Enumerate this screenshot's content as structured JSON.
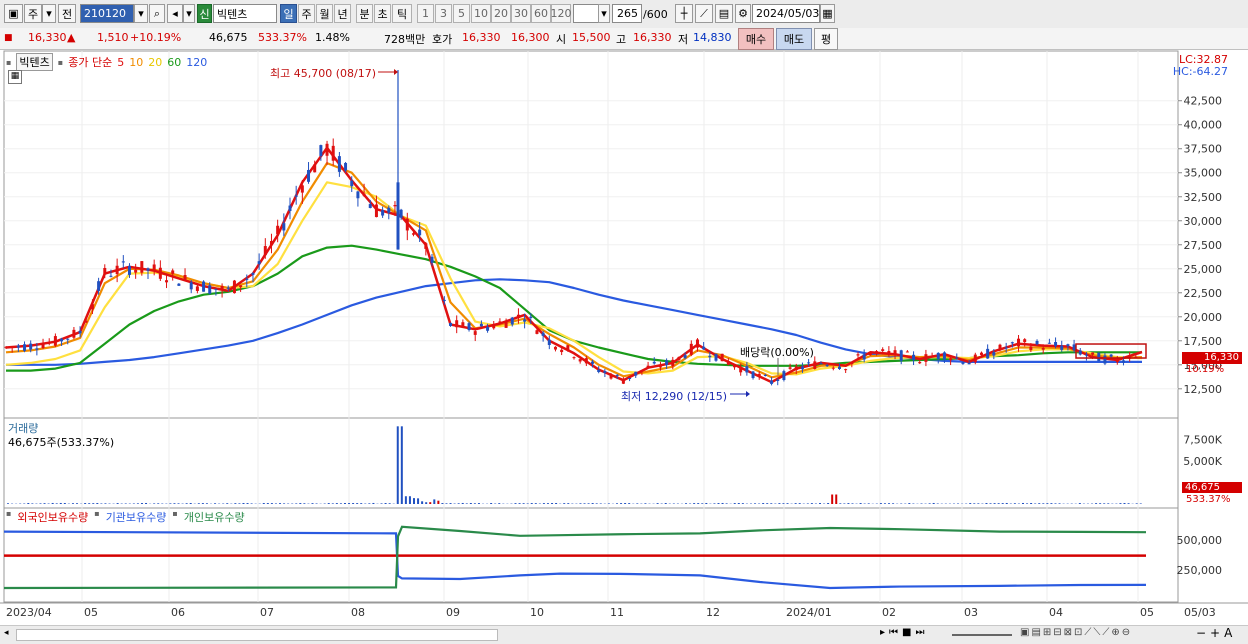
{
  "toolbar": {
    "mode_a": "주",
    "mode_b": "전",
    "code": "210120",
    "market_badge": "신",
    "stock_name": "빅텐츠",
    "periods": [
      "일",
      "주",
      "월",
      "년",
      "분",
      "초",
      "틱"
    ],
    "active_period": "일",
    "intervals": [
      "1",
      "3",
      "5",
      "10",
      "20",
      "30",
      "60",
      "120"
    ],
    "count": "265",
    "count_max": "/600",
    "date": "2024/05/03"
  },
  "quote": {
    "price": "16,330",
    "arrow": "▲",
    "change": "1,510",
    "change_pct": "+10.19%",
    "volume": "46,675",
    "volume_ratio": "533.37%",
    "turnover": "1.48%",
    "amount": "728백만",
    "bid_label": "호가",
    "bid1": "16,330",
    "bid2": "16,300",
    "open_label": "시",
    "open": "15,500",
    "high_label": "고",
    "high": "16,330",
    "low_label": "저",
    "low": "14,830",
    "buy_button": "매수",
    "sell_button": "매도",
    "avg_button": "평"
  },
  "price_panel": {
    "legend_name": "빅텐츠",
    "ma_label": "종가 단순",
    "ma_periods": [
      "5",
      "10",
      "20",
      "60",
      "120"
    ],
    "ma_colors": [
      "#e01010",
      "#f08c00",
      "#ffe040",
      "#1a9a1a",
      "#2a5ae0"
    ],
    "lc": "LC:32.87",
    "hc": "HC:-64.27",
    "annot_high": "최고 45,700 (08/17)",
    "annot_low": "최저 12,290 (12/15)",
    "annot_div": "배당락(0.00%)",
    "last_price_tag": "16,330",
    "last_pct_tag": "10.19%"
  },
  "volume_panel": {
    "title": "거래량",
    "subtitle": "46,675주(533.37%)",
    "last_tag": "46,675",
    "pct_tag": "533.37%"
  },
  "holding_panel": {
    "legend": [
      "외국인보유수량",
      "기관보유수량",
      "개인보유수량"
    ]
  },
  "chart_data": [
    {
      "type": "candlestick",
      "title": "빅텐츠",
      "yticks": [
        12500,
        15000,
        17500,
        20000,
        22500,
        25000,
        27500,
        30000,
        32500,
        35000,
        37500,
        40000,
        42500
      ],
      "ylim": [
        10500,
        45700
      ],
      "x": [
        "2023/04",
        "05",
        "06",
        "07",
        "08",
        "09",
        "10",
        "11",
        "12",
        "2024/01",
        "02",
        "03",
        "04",
        "05",
        "05/03"
      ],
      "ma5": [
        16800,
        17000,
        17400,
        18400,
        24500,
        25200,
        24800,
        24000,
        23200,
        22700,
        24500,
        28500,
        34000,
        37600,
        34200,
        31200,
        30500,
        27500,
        19200,
        18700,
        19300,
        20200,
        17500,
        16200,
        14500,
        13400,
        14700,
        15200,
        17100,
        15600,
        14400,
        13200,
        14600,
        15200,
        14900,
        16300,
        16100,
        15600,
        16100,
        15300,
        16400,
        17200,
        17000,
        16900,
        15800,
        15500,
        16330
      ],
      "ma10": [
        16300,
        16500,
        16900,
        17800,
        23500,
        25000,
        24900,
        24300,
        23500,
        23000,
        23700,
        27000,
        32000,
        36000,
        35000,
        32000,
        30500,
        29000,
        21500,
        18800,
        19200,
        19800,
        18200,
        16800,
        15000,
        13800,
        14300,
        14800,
        16500,
        16000,
        14900,
        13700,
        14200,
        14900,
        15000,
        15900,
        16000,
        15800,
        15900,
        15500,
        16100,
        16800,
        16800,
        16700,
        16000,
        15700,
        15800
      ],
      "ma20": [
        15000,
        15200,
        15600,
        16500,
        21000,
        24500,
        24600,
        24200,
        23500,
        23000,
        23200,
        25500,
        30000,
        34000,
        33500,
        32500,
        30500,
        29500,
        24000,
        19500,
        19000,
        19400,
        18800,
        17500,
        15800,
        14300,
        14100,
        14400,
        15800,
        15900,
        15200,
        14100,
        14000,
        14600,
        14900,
        15400,
        15700,
        15800,
        15800,
        15700,
        15900,
        16400,
        16600,
        16600,
        16200,
        15800,
        15700
      ],
      "ma60": [
        14400,
        14400,
        14600,
        15200,
        17200,
        19200,
        20600,
        21600,
        22300,
        22600,
        23200,
        24500,
        26300,
        27200,
        27400,
        27000,
        26500,
        26000,
        25200,
        24200,
        23000,
        20800,
        18600,
        17500,
        16800,
        16200,
        15600,
        15300,
        15100,
        15000,
        14900,
        14900,
        14900,
        15000,
        15200,
        15300,
        15400,
        15500,
        15600,
        15700,
        15900,
        16000,
        16200,
        16300,
        16300,
        16300,
        16300
      ],
      "ma120": [
        15000,
        15000,
        15000,
        15100,
        15300,
        15500,
        15800,
        16200,
        16600,
        17000,
        17500,
        18300,
        19200,
        20200,
        21200,
        22000,
        22600,
        23200,
        23500,
        23800,
        23900,
        23800,
        23600,
        23000,
        22300,
        21700,
        21200,
        20700,
        20200,
        19700,
        19200,
        18700,
        18100,
        17300,
        16600,
        16100,
        15800,
        15600,
        15400,
        15300,
        15300,
        15300,
        15300,
        15300,
        15300,
        15300,
        15300
      ]
    },
    {
      "type": "bar",
      "title": "거래량",
      "yticks": [
        5000000,
        7500000
      ],
      "ylabels": [
        "5,000K",
        "7,500K"
      ]
    },
    {
      "type": "line",
      "series": [
        {
          "name": "외국인보유수량",
          "color": "#d40000"
        },
        {
          "name": "기관보유수량",
          "color": "#2a5ae0"
        },
        {
          "name": "개인보유수량",
          "color": "#2a8a4a"
        }
      ],
      "yticks": [
        250000,
        500000
      ],
      "ylabels": [
        "250,000",
        "500,000"
      ]
    }
  ]
}
